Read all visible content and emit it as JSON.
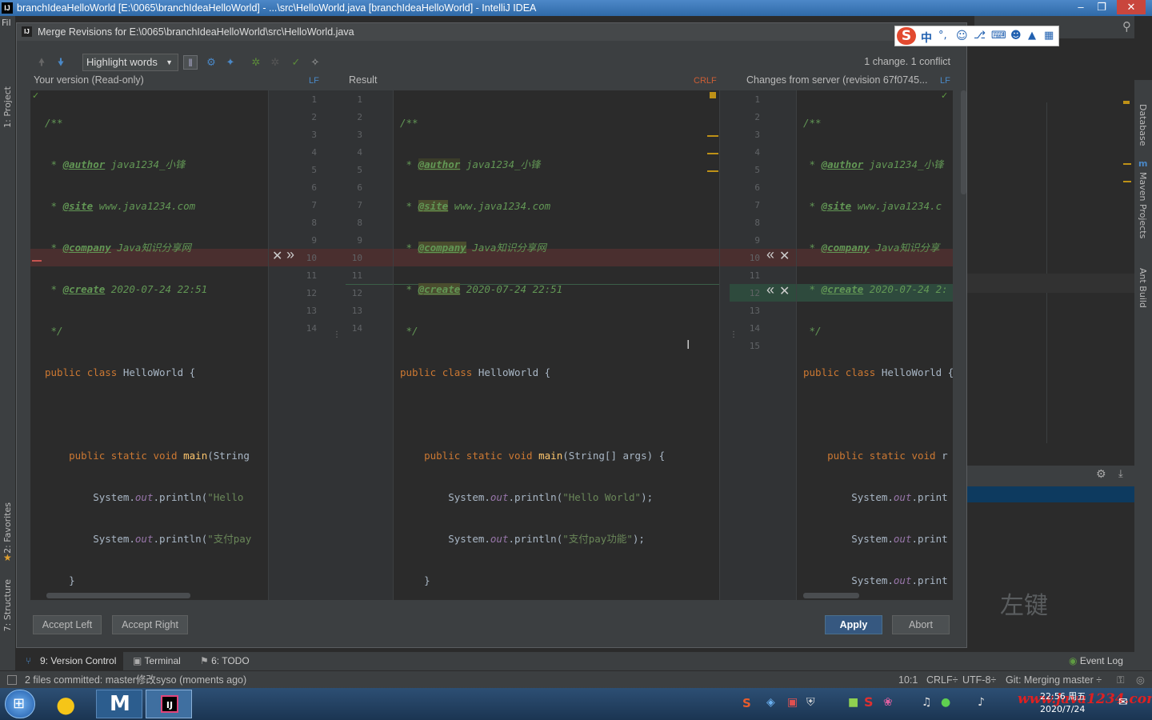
{
  "window": {
    "title": "branchIdeaHelloWorld [E:\\0065\\branchIdeaHelloWorld] - ...\\src\\HelloWorld.java [branchIdeaHelloWorld] - IntelliJ IDEA",
    "logo": "IJ",
    "menu_stub": "Fil"
  },
  "dialog": {
    "title": "Merge Revisions for E:\\0065\\branchIdeaHelloWorld\\src\\HelloWorld.java",
    "highlight_select": "Highlight words",
    "conflict_summary": "1 change. 1 conflict",
    "left_header": "Your version (Read-only)",
    "left_lf": "LF",
    "center_header": "Result",
    "center_crlf": "CRLF",
    "right_header": "Changes from server (revision 67f0745...",
    "right_lf": "LF",
    "accept_left": "Accept Left",
    "accept_right": "Accept Right",
    "apply": "Apply",
    "abort": "Abort"
  },
  "code": {
    "l1": "/**",
    "author_tag": "@author",
    "author_val": " java1234_小锋",
    "site_tag": "@site",
    "site_val": " www.java1234.com",
    "company_tag": "@company",
    "company_val": " Java知识分享网",
    "create_tag": "@create",
    "create_val": " 2020-07-24 22:51",
    "end_comment": "*/",
    "kw_public": "public",
    "kw_class": "class",
    "class_name": "HelloWorld {",
    "kw_static": "static",
    "kw_void": "void",
    "main": "main",
    "main_args": "(String[] args) {",
    "main_args_left": "(String",
    "system": "System.",
    "out": "out",
    "println": ".println(",
    "hello_str": "\"Hello World\"",
    "hello_left": "\"Hello",
    "pay_str": "\"支付pay功能\"",
    "pay_left": "\"支付pay",
    "right_print": ".print",
    "end_stmt": ");",
    "brace_close": "}",
    "right_site_val": " www.java1234.c",
    "right_company_val": " Java知识分享",
    "right_create_val": " 2020-07-24 2:"
  },
  "gutter": {
    "left": [
      "1",
      "2",
      "3",
      "4",
      "5",
      "6",
      "7",
      "8",
      "9",
      "10",
      "11",
      "12",
      "13",
      "14"
    ],
    "center": [
      "1",
      "2",
      "3",
      "4",
      "5",
      "6",
      "7",
      "8",
      "9",
      "10",
      "11",
      "12",
      "13",
      "14"
    ],
    "right": [
      "1",
      "2",
      "3",
      "4",
      "5",
      "6",
      "7",
      "8",
      "9",
      "10",
      "11",
      "12",
      "13",
      "14",
      "15"
    ]
  },
  "side_tabs": {
    "project": "1: Project",
    "favorites": "2: Favorites",
    "structure": "7: Structure",
    "database": "Database",
    "maven": "Maven Projects",
    "ant": "Ant Build"
  },
  "tool_tabs": {
    "version_control": "9: Version Control",
    "terminal": "Terminal",
    "todo": "6: TODO",
    "event_log": "Event Log"
  },
  "status": {
    "message": "2 files committed: master修改syso (moments ago)",
    "position": "10:1",
    "line_sep": "CRLF÷",
    "encoding": "UTF-8÷",
    "vcs": "Git: Merging master ÷"
  },
  "overlay": {
    "watermark_key": "左键",
    "site_watermark": "www.java1234.com"
  },
  "ime": {
    "logo": "S",
    "lang": "中"
  },
  "taskbar": {
    "time": "22:56 周五",
    "date": "2020/7/24"
  },
  "colors": {
    "conflict_bg": "#4a2f2f",
    "change_bg": "#2e4a3d",
    "accent": "#365880"
  }
}
